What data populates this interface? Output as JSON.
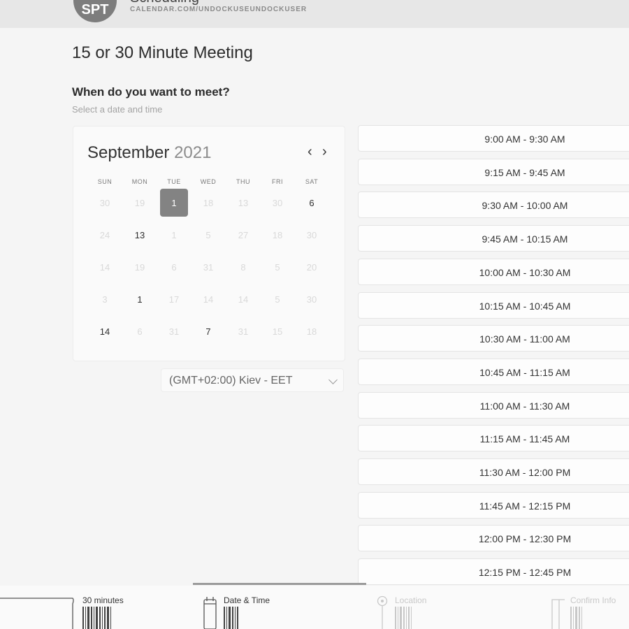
{
  "header": {
    "avatar_initials": "SPT",
    "org_name": "Scheduling",
    "url": "CALENDAR.COM/UNDOCKUSEUNDOCKUSER"
  },
  "page_title": "15 or 30 Minute Meeting",
  "question": "When do you want to meet?",
  "subtitle": "Select a date and time",
  "calendar": {
    "month": "September",
    "year": "2021",
    "prev_icon": "‹",
    "next_icon": "›",
    "weekdays": [
      "SUN",
      "MON",
      "TUE",
      "WED",
      "THU",
      "FRI",
      "SAT"
    ],
    "weeks": [
      [
        {
          "d": "30",
          "a": false
        },
        {
          "d": "19",
          "a": false
        },
        {
          "d": "1",
          "a": true,
          "sel": true
        },
        {
          "d": "18",
          "a": false
        },
        {
          "d": "13",
          "a": false
        },
        {
          "d": "30",
          "a": false
        },
        {
          "d": "6",
          "a": true
        }
      ],
      [
        {
          "d": "24",
          "a": false
        },
        {
          "d": "13",
          "a": true
        },
        {
          "d": "1",
          "a": false
        },
        {
          "d": "5",
          "a": false
        },
        {
          "d": "27",
          "a": false
        },
        {
          "d": "18",
          "a": false
        },
        {
          "d": "30",
          "a": false
        }
      ],
      [
        {
          "d": "14",
          "a": false
        },
        {
          "d": "19",
          "a": false
        },
        {
          "d": "6",
          "a": false
        },
        {
          "d": "31",
          "a": false
        },
        {
          "d": "8",
          "a": false
        },
        {
          "d": "5",
          "a": false
        },
        {
          "d": "20",
          "a": false
        }
      ],
      [
        {
          "d": "3",
          "a": false
        },
        {
          "d": "1",
          "a": true
        },
        {
          "d": "17",
          "a": false
        },
        {
          "d": "14",
          "a": false
        },
        {
          "d": "14",
          "a": false
        },
        {
          "d": "5",
          "a": false
        },
        {
          "d": "30",
          "a": false
        }
      ],
      [
        {
          "d": "14",
          "a": true
        },
        {
          "d": "6",
          "a": false
        },
        {
          "d": "31",
          "a": false
        },
        {
          "d": "7",
          "a": true
        },
        {
          "d": "31",
          "a": false
        },
        {
          "d": "15",
          "a": false
        },
        {
          "d": "18",
          "a": false
        }
      ]
    ]
  },
  "timezone": "(GMT+02:00) Kiev - EET",
  "time_slots": [
    "9:00 AM - 9:30 AM",
    "9:15 AM - 9:45 AM",
    "9:30 AM - 10:00 AM",
    "9:45 AM - 10:15 AM",
    "10:00 AM - 10:30 AM",
    "10:15 AM - 10:45 AM",
    "10:30 AM - 11:00 AM",
    "10:45 AM - 11:15 AM",
    "11:00 AM - 11:30 AM",
    "11:15 AM - 11:45 AM",
    "11:30 AM - 12:00 PM",
    "11:45 AM - 12:15 PM",
    "12:00 PM - 12:30 PM",
    "12:15 PM - 12:45 PM"
  ],
  "steps": [
    {
      "label": "30 minutes",
      "active": true,
      "icon": "duration-icon"
    },
    {
      "label": "Date & Time",
      "active": true,
      "icon": "calendar-icon"
    },
    {
      "label": "Location",
      "active": false,
      "icon": "location-pin-icon"
    },
    {
      "label": "Confirm Info",
      "active": false,
      "icon": "confirm-icon"
    }
  ],
  "colors": {
    "selected_day": "#838383",
    "progress": "#9a9a9a"
  }
}
